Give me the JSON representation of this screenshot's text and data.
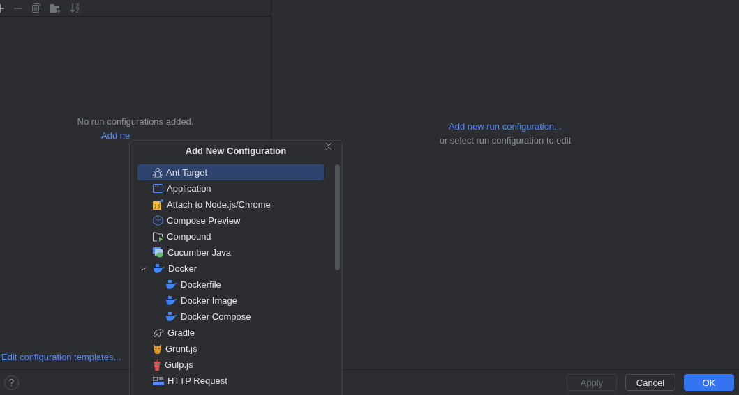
{
  "toolbar": {
    "buttons": [
      {
        "kind": "add",
        "disabled": false
      },
      {
        "kind": "remove",
        "disabled": true
      },
      {
        "kind": "copy",
        "disabled": true
      },
      {
        "kind": "folder",
        "disabled": true
      },
      {
        "kind": "sort",
        "disabled": true
      }
    ]
  },
  "left_panel": {
    "empty_message": "No run configurations added.",
    "add_link": "Add ne",
    "templates_link": "Edit configuration templates..."
  },
  "right_panel": {
    "link": "Add new run configuration...",
    "hint": "or select run configuration to edit"
  },
  "popup": {
    "title": "Add New Configuration",
    "items": [
      {
        "label": "Ant Target",
        "selected": true
      },
      {
        "label": "Application",
        "selected": false
      },
      {
        "label": "Attach to Node.js/Chrome",
        "selected": false
      },
      {
        "label": "Compose Preview",
        "selected": false
      },
      {
        "label": "Compound",
        "selected": false
      },
      {
        "label": "Cucumber Java",
        "selected": false
      },
      {
        "label": "Docker",
        "selected": false,
        "expanded": true,
        "children": [
          {
            "label": "Dockerfile",
            "selected": false
          },
          {
            "label": "Docker Image",
            "selected": false
          },
          {
            "label": "Docker Compose",
            "selected": false
          }
        ]
      },
      {
        "label": "Gradle",
        "selected": false
      },
      {
        "label": "Grunt.js",
        "selected": false
      },
      {
        "label": "Gulp.js",
        "selected": false
      },
      {
        "label": "HTTP Request",
        "selected": false
      }
    ]
  },
  "buttons": [
    {
      "label": "Apply",
      "disabled": true,
      "primary": false
    },
    {
      "label": "Cancel",
      "disabled": false,
      "primary": false
    },
    {
      "label": "OK",
      "disabled": false,
      "primary": true
    }
  ],
  "help": "?"
}
